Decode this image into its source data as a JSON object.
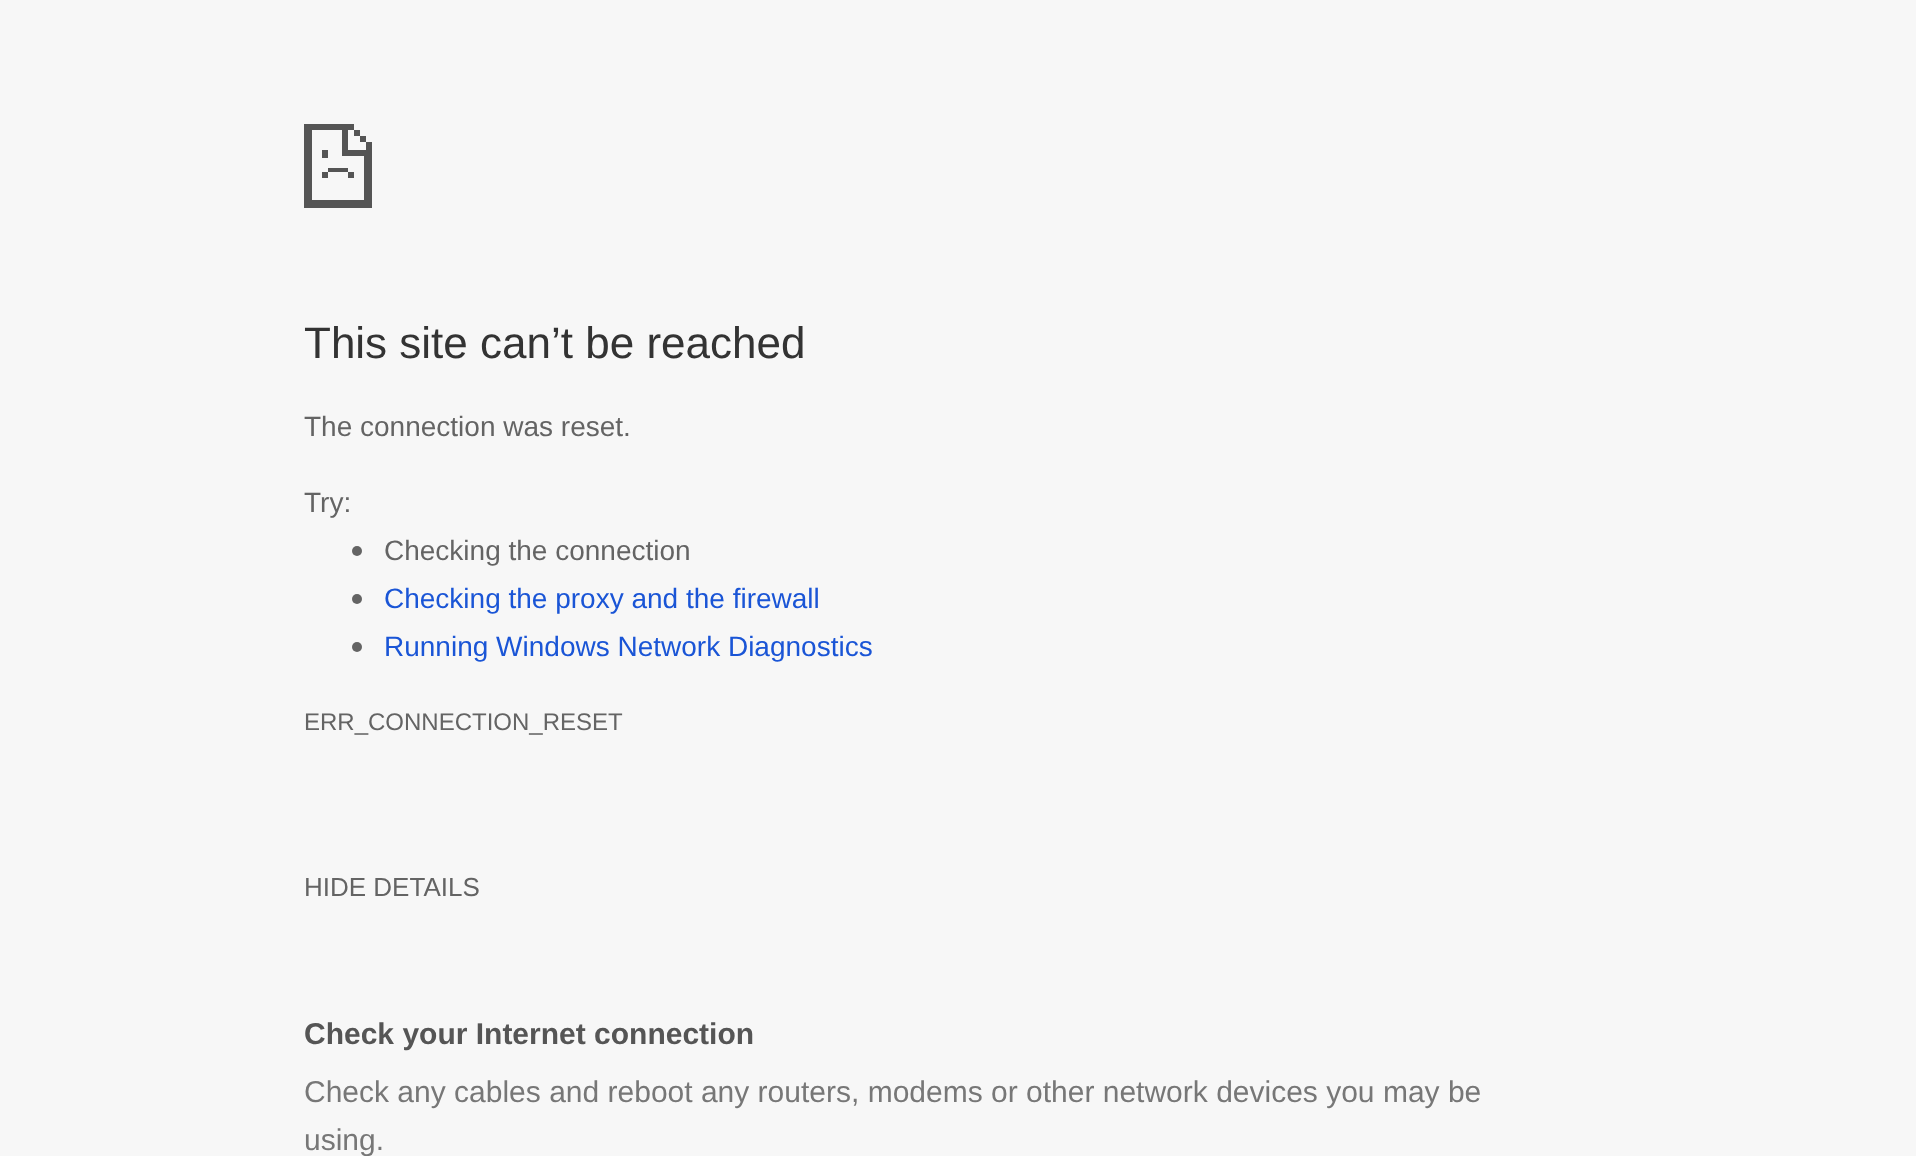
{
  "heading": "This site can’t be reached",
  "message": "The connection was reset.",
  "suggestions_label": "Try:",
  "suggestions": [
    {
      "kind": "text",
      "text": "Checking the connection"
    },
    {
      "kind": "link",
      "text": "Checking the proxy and the firewall"
    },
    {
      "kind": "link",
      "text": "Running Windows Network Diagnostics"
    }
  ],
  "error_code": "ERR_CONNECTION_RESET",
  "details_button": "HIDE DETAILS",
  "details": {
    "heading": "Check your Internet connection",
    "text": "Check any cables and reboot any routers, modems or other network devices you may be using."
  }
}
